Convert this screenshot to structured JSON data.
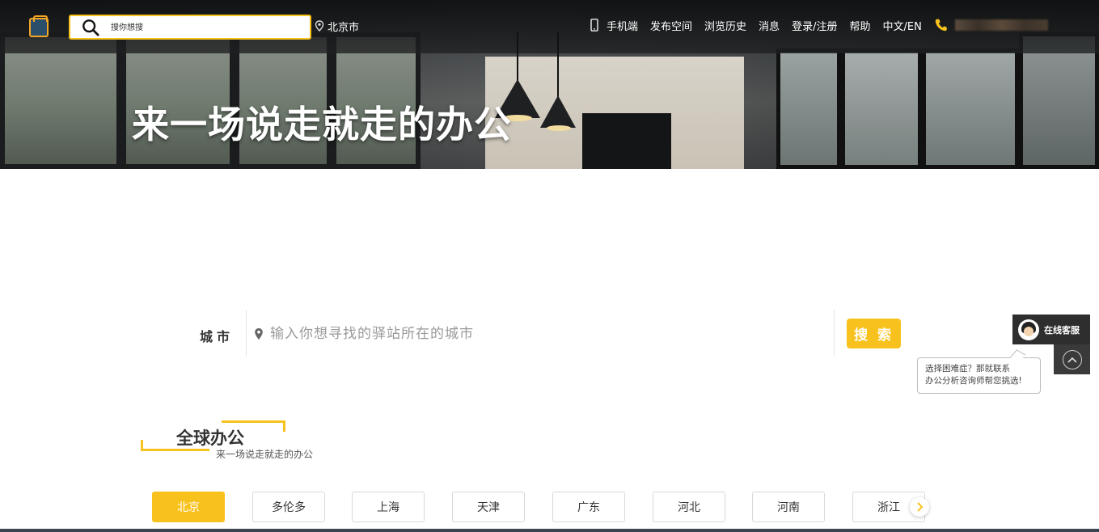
{
  "header": {
    "search_placeholder": "搜你想搜",
    "city": "北京市",
    "nav": {
      "mobile": "手机端",
      "publish": "发布空间",
      "history": "浏览历史",
      "messages": "消息",
      "login": "登录/注册",
      "help": "帮助",
      "language": "中文/EN"
    }
  },
  "hero": {
    "slogan": "来一场说走就走的办公"
  },
  "city_search": {
    "label": "城市",
    "placeholder": "输入你想寻找的驿站所在的城市",
    "button": "搜 索"
  },
  "customer_service": {
    "label": "在线客服",
    "bubble_line1": "选择困难症？那就联系",
    "bubble_line2": "办公分析咨询师帮您挑选!"
  },
  "section": {
    "title": "全球办公",
    "subtitle": "来一场说走就走的办公"
  },
  "city_tabs": [
    {
      "label": "北京",
      "active": true
    },
    {
      "label": "多伦多",
      "active": false
    },
    {
      "label": "上海",
      "active": false
    },
    {
      "label": "天津",
      "active": false
    },
    {
      "label": "广东",
      "active": false
    },
    {
      "label": "河北",
      "active": false
    },
    {
      "label": "河南",
      "active": false
    },
    {
      "label": "浙江",
      "active": false
    }
  ],
  "colors": {
    "accent": "#f8c21e",
    "dark_panel": "#2e2e2e"
  },
  "icons": {
    "logo": "logo-icon",
    "search": "search-icon",
    "location": "location-pin-icon",
    "mobile": "mobile-phone-icon",
    "phone": "phone-icon",
    "back_to_top": "chevron-up-icon",
    "next": "chevron-right-icon"
  }
}
